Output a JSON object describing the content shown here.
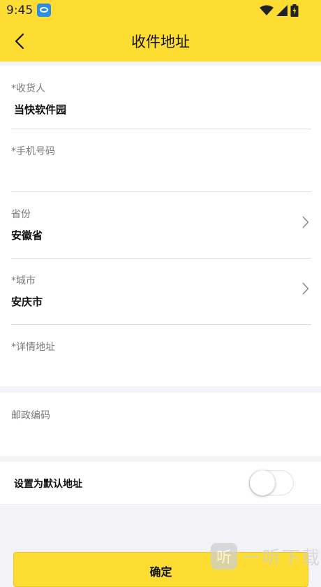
{
  "status_bar": {
    "time": "9:45",
    "icons": [
      "app-notification-icon",
      "wifi-icon",
      "cell-signal-icon",
      "battery-charging-icon"
    ]
  },
  "header": {
    "title": "收件地址",
    "back_icon": "back-arrow-icon",
    "background_color": "#fddd32"
  },
  "form": {
    "receiver": {
      "label": "*收货人",
      "value": "当快软件园"
    },
    "phone": {
      "label": "*手机号码",
      "value": ""
    },
    "province": {
      "label": "省份",
      "value": "安徽省",
      "icon": "chevron-right-icon"
    },
    "city": {
      "label": "*城市",
      "value": "安庆市",
      "icon": "chevron-right-icon"
    },
    "detail_address": {
      "label": "*详情地址",
      "value": ""
    },
    "postal_code": {
      "label": "邮政编码",
      "value": ""
    }
  },
  "default_address": {
    "label": "设置为默认地址",
    "enabled": false
  },
  "confirm_button": {
    "label": "确定"
  },
  "watermark": {
    "badge": "听",
    "text": "一听下载"
  }
}
